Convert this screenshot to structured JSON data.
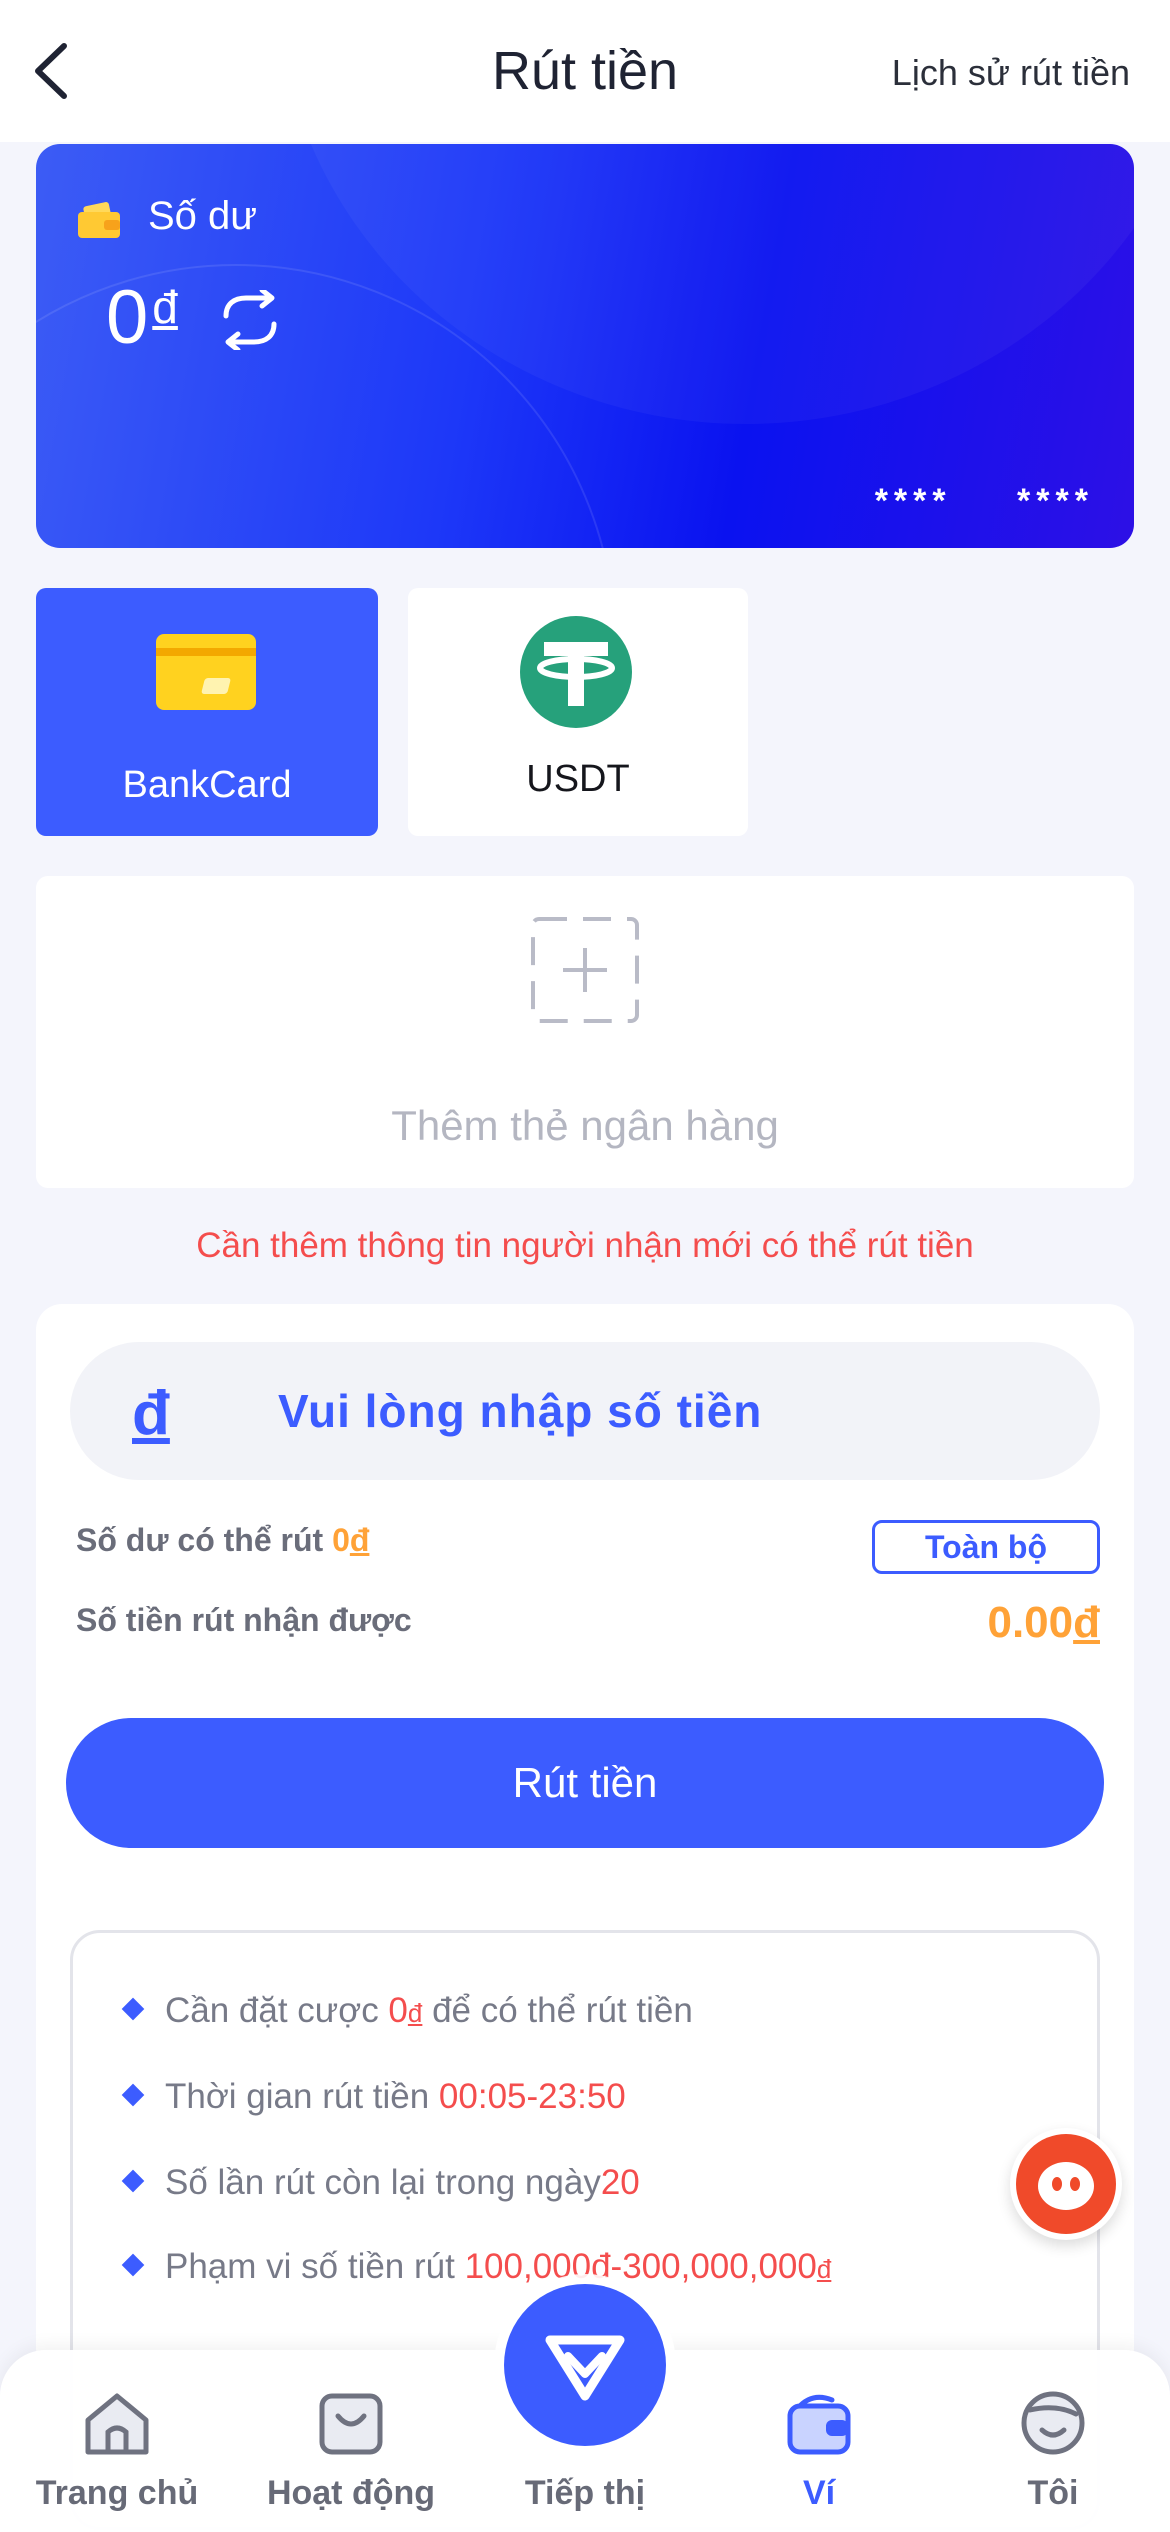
{
  "header": {
    "title": "Rút tiền",
    "history_link": "Lịch sử rút tiền"
  },
  "balance_card": {
    "label": "Số dư",
    "amount": "0",
    "currency": "đ",
    "masked_number": "**** ****"
  },
  "methods": [
    {
      "label": "BankCard",
      "selected": true
    },
    {
      "label": "USDT",
      "selected": false
    }
  ],
  "add_card": {
    "label": "Thêm thẻ ngân hàng"
  },
  "warning": "Cần thêm thông tin người nhận mới có thể rút tiền",
  "withdraw": {
    "currency_symbol": "đ",
    "placeholder": "Vui lòng nhập số tiền",
    "available_label": "Số dư có thể rút",
    "available_value": "0",
    "available_currency": "đ",
    "all_button": "Toàn bộ",
    "receive_label": "Số tiền rút nhận được",
    "receive_value": "0.00",
    "receive_currency": "đ",
    "submit_button": "Rút tiền"
  },
  "rules": [
    {
      "prefix": "Cần đặt cược ",
      "highlight": "0",
      "currency": "đ",
      "suffix": " để có thể rút tiền"
    },
    {
      "prefix": "Thời gian rút tiền ",
      "highlight": "00:05-23:50",
      "currency": "",
      "suffix": ""
    },
    {
      "prefix": "Số lần rút còn lại trong ngày",
      "highlight": "20",
      "currency": "",
      "suffix": ""
    },
    {
      "prefix": "Phạm vi số tiền rút ",
      "highlight": "100,000đ-300,000,000",
      "currency": "đ",
      "suffix": ""
    }
  ],
  "tabbar": {
    "items": [
      {
        "label": "Trang chủ",
        "icon": "home-icon"
      },
      {
        "label": "Hoạt động",
        "icon": "activity-bag-icon"
      },
      {
        "label": "Tiếp thị",
        "icon": "diamond-icon"
      },
      {
        "label": "Ví",
        "icon": "wallet-icon",
        "active": true
      },
      {
        "label": "Tôi",
        "icon": "profile-face-icon"
      }
    ]
  },
  "colors": {
    "primary": "#3c5cff",
    "accent_orange": "#ffa237",
    "warning_red": "#f44d4d",
    "background": "#f4f5fc"
  }
}
